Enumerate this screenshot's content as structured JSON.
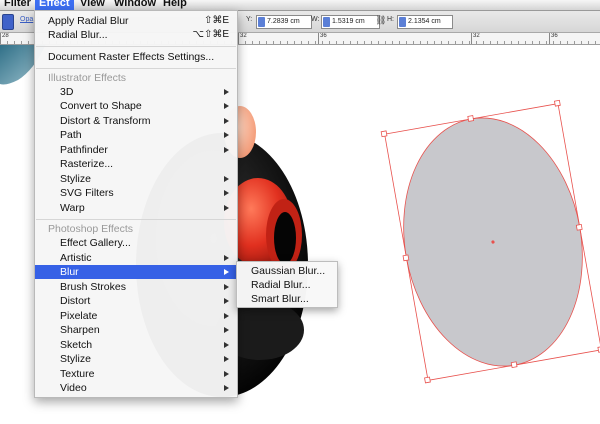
{
  "menubar": {
    "items": [
      {
        "label": "Filter"
      },
      {
        "label": "Effect"
      },
      {
        "label": "View"
      },
      {
        "label": "Window"
      },
      {
        "label": "Help"
      }
    ]
  },
  "controlbar": {
    "opacity_label": "Opa",
    "y_label": "Y:",
    "y_value": "7.2839 cm",
    "w_label": "W:",
    "w_value": "1.5319 cm",
    "h_label": "H:",
    "h_value": "2.1354 cm"
  },
  "ruler": {
    "numbers": [
      "28",
      "32",
      "36",
      "32",
      "36"
    ]
  },
  "effect_menu": {
    "apply_last": {
      "label": "Apply Radial Blur",
      "shortcut": "⇧⌘E"
    },
    "last_dialog": {
      "label": "Radial Blur...",
      "shortcut": "⌥⇧⌘E"
    },
    "raster_settings": "Document Raster Effects Settings...",
    "illustrator_header": "Illustrator Effects",
    "illustrator_items": [
      {
        "label": "3D"
      },
      {
        "label": "Convert to Shape"
      },
      {
        "label": "Distort & Transform"
      },
      {
        "label": "Path"
      },
      {
        "label": "Pathfinder"
      },
      {
        "label": "Rasterize..."
      },
      {
        "label": "Stylize"
      },
      {
        "label": "SVG Filters"
      },
      {
        "label": "Warp"
      }
    ],
    "photoshop_header": "Photoshop Effects",
    "photoshop_items": [
      {
        "label": "Effect Gallery..."
      },
      {
        "label": "Artistic"
      },
      {
        "label": "Blur"
      },
      {
        "label": "Brush Strokes"
      },
      {
        "label": "Distort"
      },
      {
        "label": "Pixelate"
      },
      {
        "label": "Sharpen"
      },
      {
        "label": "Sketch"
      },
      {
        "label": "Stylize"
      },
      {
        "label": "Texture"
      },
      {
        "label": "Video"
      }
    ]
  },
  "blur_submenu": {
    "items": [
      {
        "label": "Gaussian Blur..."
      },
      {
        "label": "Radial Blur..."
      },
      {
        "label": "Smart Blur..."
      }
    ]
  },
  "colors": {
    "menu_highlight": "#3661e6",
    "selection_red": "#e8514d",
    "ellipse_fill": "#c8c8cc"
  }
}
